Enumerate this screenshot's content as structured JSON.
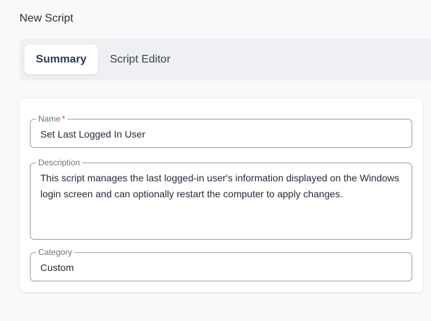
{
  "page": {
    "title": "New Script"
  },
  "tabs": [
    {
      "label": "Summary",
      "active": true
    },
    {
      "label": "Script Editor",
      "active": false
    }
  ],
  "form": {
    "name": {
      "label": "Name",
      "required_mark": "*",
      "value": "Set Last Logged In User"
    },
    "description": {
      "label": "Description",
      "value": "This script manages the last logged-in user's information displayed on the Windows login screen and can optionally restart the computer to apply changes."
    },
    "category": {
      "label": "Category",
      "value": "Custom"
    }
  },
  "colors": {
    "background": "#f9f9fa",
    "tab_bar": "#eff0f3",
    "required": "#d9363e",
    "active_tab_text": "#2e3a59"
  }
}
